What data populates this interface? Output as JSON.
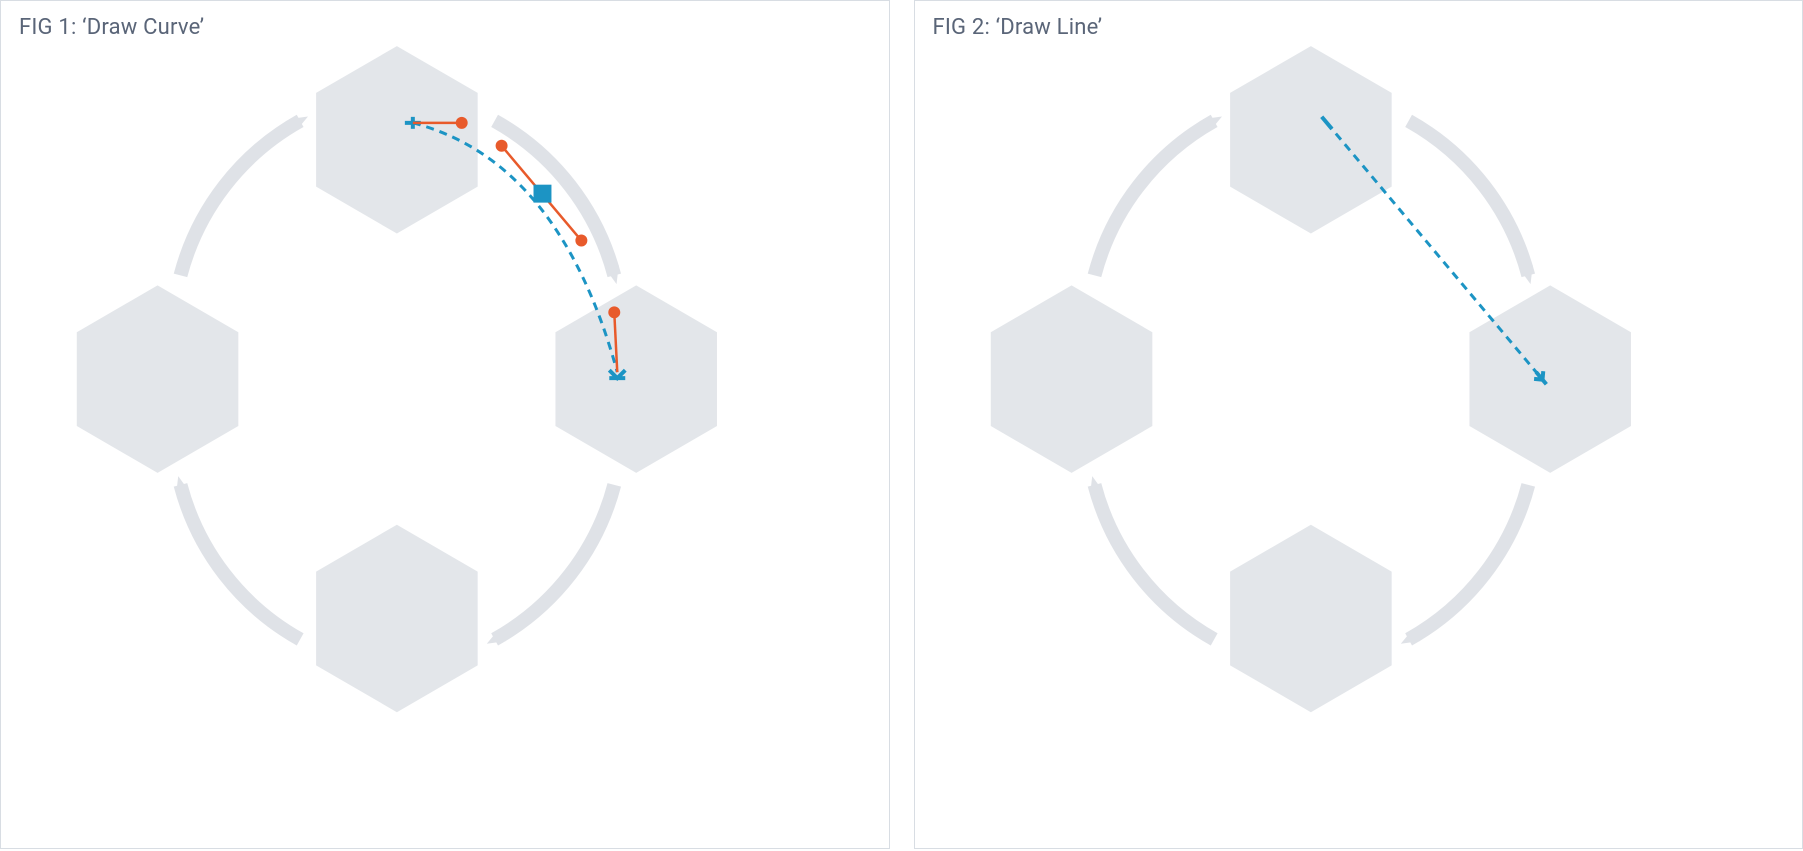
{
  "figures": [
    {
      "id": "fig1",
      "label": "FIG 1: ‘Draw Curve’"
    },
    {
      "id": "fig2",
      "label": "FIG 2: ‘Draw Line’"
    }
  ],
  "colors": {
    "hexFill": "#e3e6ea",
    "arrowStroke": "#dfe2e7",
    "curveDash": "#1c94c4",
    "controlLine": "#e85a2b",
    "controlDot": "#e85a2b",
    "midSquare": "#1c94c4",
    "endCap": "#1c94c4",
    "panelBorder": "#d8dde3",
    "titleText": "#5a6578"
  },
  "diagram": {
    "description": "Four hexagonal nodes arranged in a diamond cycle (top, right, bottom, left) connected by curved arrows forming a clockwise loop. Fig 1 overlays a dashed curved connector between top and right nodes with visible bezier control handles and a midpoint square. Fig 2 overlays a straight dashed connector between top and right nodes with end caps only.",
    "nodes": [
      "top",
      "right",
      "bottom",
      "left"
    ],
    "draw_curve": {
      "from": "top",
      "to": "right",
      "style": "dashed-bezier",
      "control_handles": 2,
      "midpoint_marker": "square"
    },
    "draw_line": {
      "from": "top",
      "to": "right",
      "style": "dashed-straight",
      "midpoint_marker": "none"
    }
  }
}
